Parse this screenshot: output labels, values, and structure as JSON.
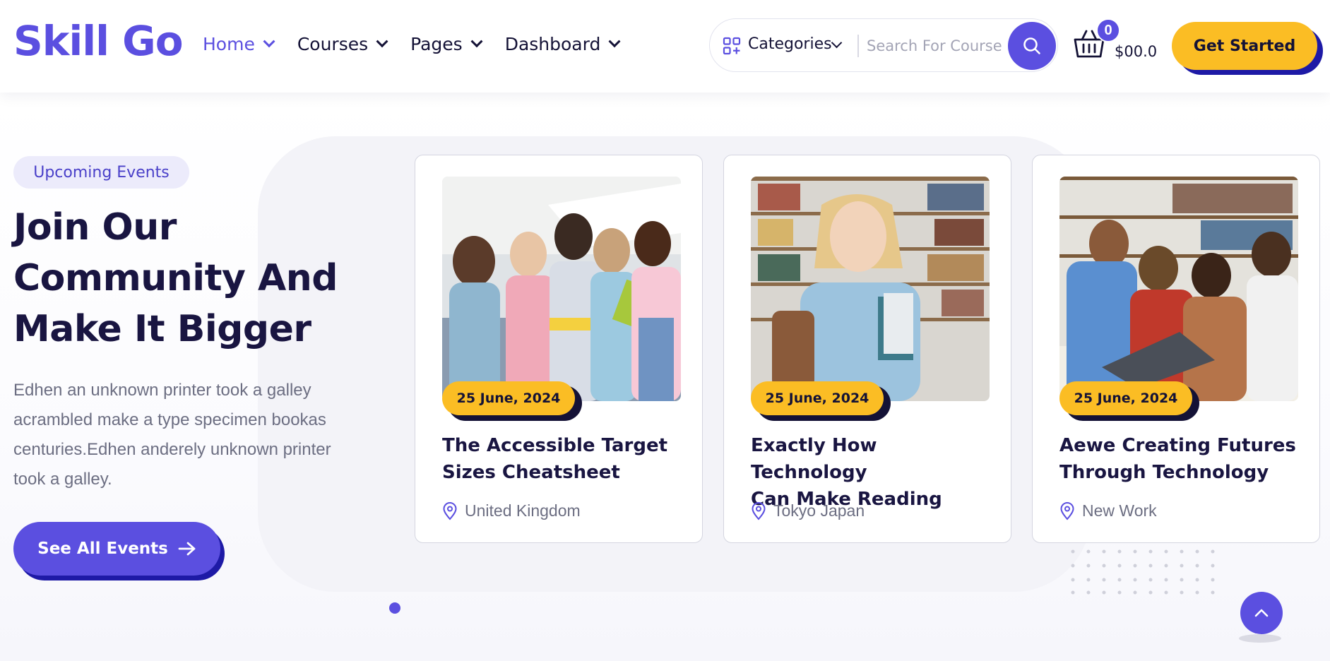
{
  "brand": {
    "logo": "Skill Go",
    "accent": "#5b4fe0",
    "yellow": "#fbbd24",
    "dark": "#191541"
  },
  "nav": [
    {
      "label": "Home",
      "active": true
    },
    {
      "label": "Courses"
    },
    {
      "label": "Pages"
    },
    {
      "label": "Dashboard"
    }
  ],
  "search": {
    "categories_label": "Categories",
    "placeholder": "Search For Course",
    "button_icon": "search-icon"
  },
  "cart": {
    "count": "0",
    "total": "$00.0"
  },
  "cta": {
    "get_started": "Get Started"
  },
  "hero": {
    "badge": "Upcoming Events",
    "heading": [
      "Join Our",
      "Community And",
      "Make It Bigger"
    ],
    "description": [
      "Edhen an unknown printer took a galley",
      "acrambled make a type specimen bookas",
      "centuries.Edhen anderely unknown printer",
      "took a galley."
    ],
    "button": "See All Events"
  },
  "events": [
    {
      "date": "25 June, 2024",
      "title_lines": [
        "The Accessible Target",
        "Sizes Cheatsheet"
      ],
      "location": "United Kingdom"
    },
    {
      "date": "25 June, 2024",
      "title_lines": [
        "Exactly How Technology",
        "Can Make Reading"
      ],
      "location": "Tokyo Japan"
    },
    {
      "date": "25 June, 2024",
      "title_lines": [
        "Aewe Creating Futures",
        "Through Technology"
      ],
      "location": "New Work"
    }
  ]
}
